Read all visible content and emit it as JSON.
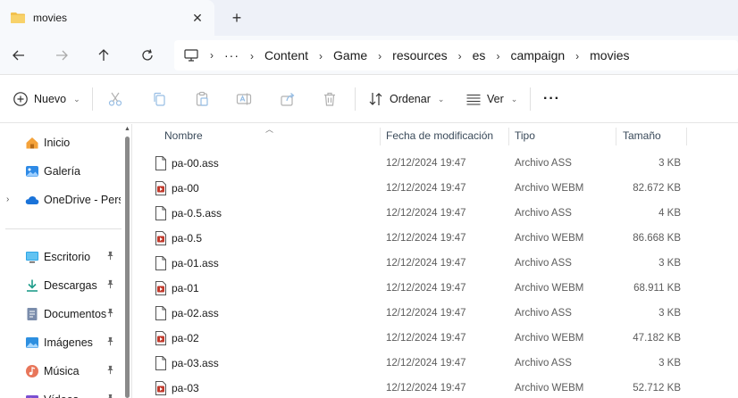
{
  "window": {
    "tab_title": "movies",
    "tab_close": "✕",
    "new_tab": "+"
  },
  "address": {
    "overflow": "···",
    "separator": "›",
    "segments": [
      "Content",
      "Game",
      "resources",
      "es",
      "campaign",
      "movies"
    ]
  },
  "toolbar": {
    "new_label": "Nuevo",
    "sort_label": "Ordenar",
    "view_label": "Ver",
    "more_label": "···"
  },
  "sidebar": {
    "items": [
      {
        "label": "Inicio",
        "icon": "home-icon"
      },
      {
        "label": "Galería",
        "icon": "gallery-icon"
      },
      {
        "label": "OneDrive - Perso",
        "icon": "cloud-icon"
      },
      {
        "label": "Escritorio",
        "icon": "desktop-icon"
      },
      {
        "label": "Descargas",
        "icon": "download-icon"
      },
      {
        "label": "Documentos",
        "icon": "documents-icon"
      },
      {
        "label": "Imágenes",
        "icon": "pictures-icon"
      },
      {
        "label": "Música",
        "icon": "music-icon"
      },
      {
        "label": "Vídeos",
        "icon": "videos-icon"
      }
    ]
  },
  "columns": {
    "name": "Nombre",
    "date": "Fecha de modificación",
    "type": "Tipo",
    "size": "Tamaño"
  },
  "files": [
    {
      "name": "pa-00.ass",
      "date": "12/12/2024 19:47",
      "type": "Archivo ASS",
      "size": "3 KB",
      "kind": "ass"
    },
    {
      "name": "pa-00",
      "date": "12/12/2024 19:47",
      "type": "Archivo WEBM",
      "size": "82.672 KB",
      "kind": "webm"
    },
    {
      "name": "pa-0.5.ass",
      "date": "12/12/2024 19:47",
      "type": "Archivo ASS",
      "size": "4 KB",
      "kind": "ass"
    },
    {
      "name": "pa-0.5",
      "date": "12/12/2024 19:47",
      "type": "Archivo WEBM",
      "size": "86.668 KB",
      "kind": "webm"
    },
    {
      "name": "pa-01.ass",
      "date": "12/12/2024 19:47",
      "type": "Archivo ASS",
      "size": "3 KB",
      "kind": "ass"
    },
    {
      "name": "pa-01",
      "date": "12/12/2024 19:47",
      "type": "Archivo WEBM",
      "size": "68.911 KB",
      "kind": "webm"
    },
    {
      "name": "pa-02.ass",
      "date": "12/12/2024 19:47",
      "type": "Archivo ASS",
      "size": "3 KB",
      "kind": "ass"
    },
    {
      "name": "pa-02",
      "date": "12/12/2024 19:47",
      "type": "Archivo WEBM",
      "size": "47.182 KB",
      "kind": "webm"
    },
    {
      "name": "pa-03.ass",
      "date": "12/12/2024 19:47",
      "type": "Archivo ASS",
      "size": "3 KB",
      "kind": "ass"
    },
    {
      "name": "pa-03",
      "date": "12/12/2024 19:47",
      "type": "Archivo WEBM",
      "size": "52.712 KB",
      "kind": "webm"
    }
  ],
  "colors": {
    "folder": "#f2c14e",
    "accent": "#0067c0",
    "webm": "#c0392b"
  }
}
